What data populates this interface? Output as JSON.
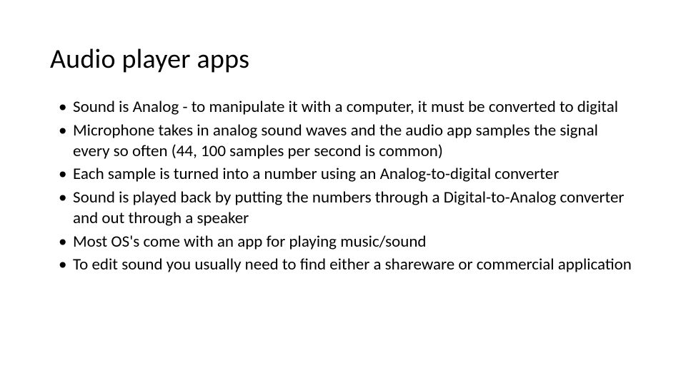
{
  "slide": {
    "title": "Audio player apps",
    "bullets": [
      "Sound is Analog  - to manipulate it with a computer, it must be converted to digital",
      "Microphone takes in analog sound waves and the audio app samples the signal every so often (44, 100 samples per second is common)",
      "Each sample is turned into a number using an Analog-to-digital converter",
      "Sound is played back by putting the numbers through a Digital-to-Analog converter and out through a speaker",
      "Most OS's come with an app for playing music/sound",
      "To edit sound you usually need to find either a shareware or commercial application"
    ]
  }
}
